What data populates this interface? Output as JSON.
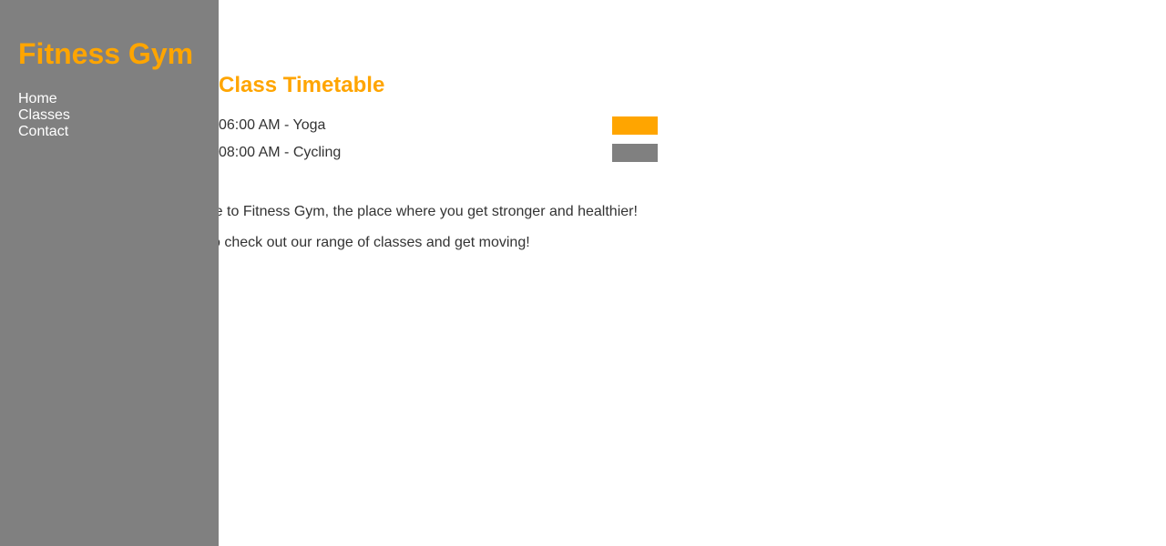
{
  "brand": {
    "name": "Fitness Gym",
    "color": "#FFA500"
  },
  "sidebar": {
    "background": "#808080",
    "items": [
      {
        "label": "Home"
      },
      {
        "label": "Classes"
      },
      {
        "label": "Contact"
      }
    ]
  },
  "timetable": {
    "title": "Class Timetable",
    "classes": [
      {
        "label": "06:00 AM - Yoga",
        "color": "#FFA500"
      },
      {
        "label": "08:00 AM - Cycling",
        "color": "#808080"
      }
    ]
  },
  "welcome": {
    "line1": "elcome to Fitness Gym, the place where you get stronger and healthier!",
    "line2": "sure to check out our range of classes and get moving!"
  }
}
